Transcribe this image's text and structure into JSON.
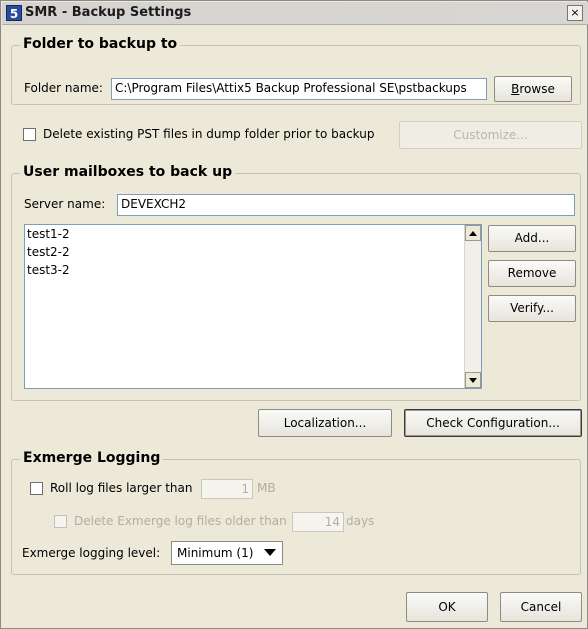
{
  "window": {
    "app_icon": "5",
    "title": "SMR - Backup Settings",
    "close_glyph": "×"
  },
  "folder_group": {
    "legend": "Folder to backup to",
    "folder_label": "Folder name:",
    "folder_value": "C:\\Program Files\\Attix5 Backup Professional SE\\pstbackups",
    "browse_label_underlined": "B",
    "browse_label_rest": "rowse"
  },
  "delete_pst": {
    "label": "Delete existing PST files in dump folder prior to backup",
    "checked": false,
    "customize_label": "Customize..."
  },
  "mailboxes_group": {
    "legend": "User mailboxes to back up",
    "server_label": "Server name:",
    "server_value": "DEVEXCH2",
    "mailboxes": [
      "test1-2",
      "test2-2",
      "test3-2"
    ],
    "add_label": "Add...",
    "remove_label": "Remove",
    "verify_label": "Verify..."
  },
  "actions": {
    "localization_label": "Localization...",
    "check_config_label": "Check Configuration..."
  },
  "logging_group": {
    "legend": "Exmerge Logging",
    "roll_label": "Roll log files larger than",
    "roll_value": "1",
    "roll_unit": "MB",
    "delete_label": "Delete Exmerge log files older than",
    "delete_value": "14",
    "delete_unit": "days",
    "level_label": "Exmerge logging level:",
    "level_value": "Minimum (1)"
  },
  "footer": {
    "ok_label": "OK",
    "cancel_label": "Cancel"
  }
}
